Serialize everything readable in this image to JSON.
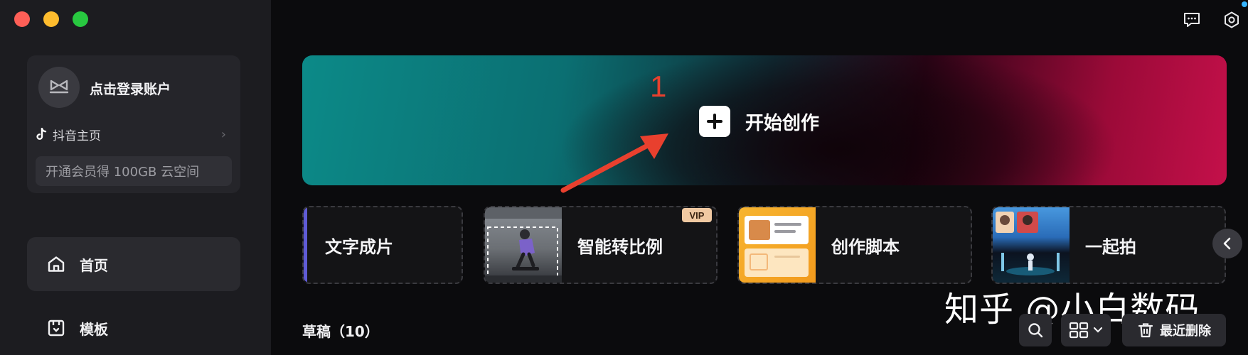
{
  "window": {
    "traffic_lights": [
      "close",
      "minimize",
      "maximize"
    ]
  },
  "account": {
    "login_text": "点击登录账户",
    "douyin_label": "抖音主页",
    "vip_promo": "开通会员得 100GB 云空间"
  },
  "nav": {
    "items": [
      {
        "label": "首页",
        "icon": "home-icon",
        "active": true
      },
      {
        "label": "模板",
        "icon": "template-icon",
        "active": false
      }
    ]
  },
  "topbar": {
    "icons": [
      "message-icon",
      "settings-icon"
    ]
  },
  "hero": {
    "annotation_number": "1",
    "label": "开始创作"
  },
  "features": [
    {
      "label": "文字成片"
    },
    {
      "label": "智能转比例",
      "badge": "VIP"
    },
    {
      "label": "创作脚本"
    },
    {
      "label": "一起拍"
    }
  ],
  "drafts": {
    "title": "草稿（10）",
    "delete_label": "最近删除"
  },
  "watermark": "知乎 @小白数码",
  "colors": {
    "accent_purple": "#5f5bd6",
    "annotation_red": "#e8402e",
    "vip_badge": "#f0c9a2",
    "sidebar_bg": "#1c1c20"
  }
}
